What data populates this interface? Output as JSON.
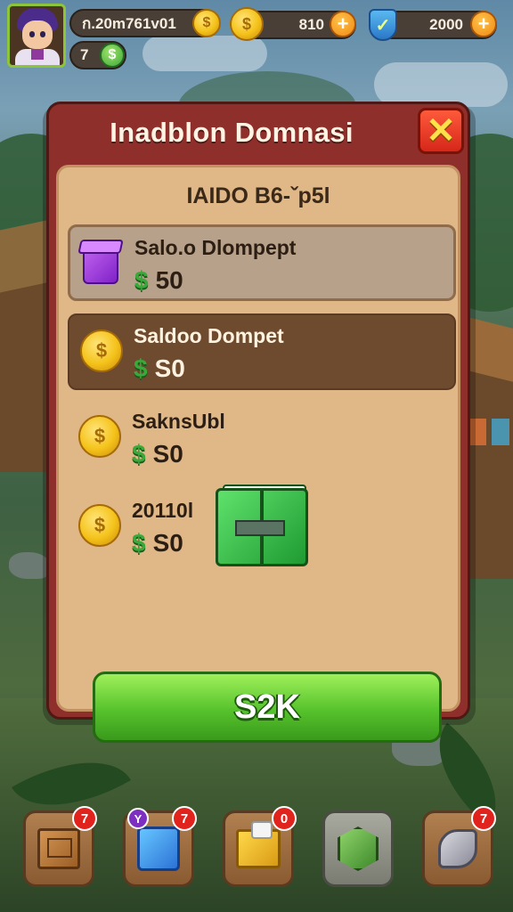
{
  "hud": {
    "player_name": "ก.20m761v01",
    "level": "7",
    "coins": "810",
    "gems": "2000",
    "plus_symbol": "+",
    "coin_symbol": "$",
    "check_symbol": "✓"
  },
  "dialog": {
    "title": "Inadblon Domnasi",
    "close_symbol": "✕",
    "header": "IAIDO B6-ˇp5l",
    "rows": [
      {
        "title": "Salo.o Dlompept",
        "currency": "$",
        "amount": "50",
        "icon": "purple-box-icon"
      },
      {
        "title": "Saldoo Dompet",
        "currency": "$",
        "amount": "S0",
        "icon": "gold-coin-icon"
      },
      {
        "title": "SaknsUbl",
        "currency": "$",
        "amount": "S0",
        "icon": "gold-coin-icon"
      },
      {
        "title": "20110l",
        "currency": "$",
        "amount": "S0",
        "icon": "gold-coin-icon"
      }
    ],
    "confirm_label": "S2K"
  },
  "bottom_bar": [
    {
      "icon": "wooden-crate-icon",
      "badge": "7"
    },
    {
      "icon": "blue-box-icon",
      "badge": "7",
      "badge_secondary": "Y"
    },
    {
      "icon": "gold-chest-icon",
      "badge": "0"
    },
    {
      "icon": "green-gem-icon",
      "badge": ""
    },
    {
      "icon": "key-tag-icon",
      "badge": "7"
    }
  ],
  "colors": {
    "dialog_frame": "#8e2f2c",
    "panel": "#e0b786",
    "confirm_button": "#56c22c",
    "close_button": "#d6271a",
    "currency_green": "#3aa83a"
  }
}
